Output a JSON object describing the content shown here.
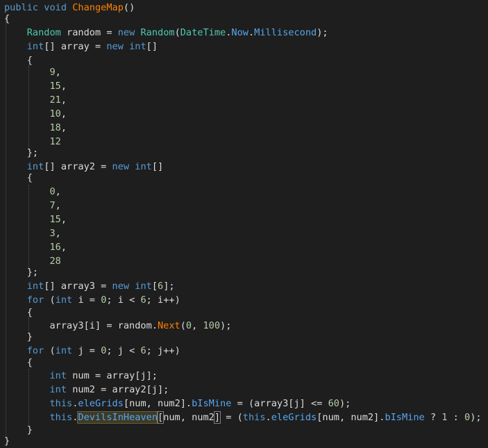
{
  "editor": {
    "lines": [
      [
        [
          "public ",
          "kw"
        ],
        [
          "void ",
          "kw"
        ],
        [
          "ChangeMap",
          "fn"
        ],
        [
          "()",
          "pl"
        ]
      ],
      [
        [
          "{",
          "pl"
        ]
      ],
      [
        [
          "    ",
          "pl"
        ],
        [
          "Random",
          "ty"
        ],
        [
          " random = ",
          "pl"
        ],
        [
          "new ",
          "kw"
        ],
        [
          "Random",
          "ty"
        ],
        [
          "(",
          "pl"
        ],
        [
          "DateTime",
          "ty"
        ],
        [
          ".",
          "pl"
        ],
        [
          "Now",
          "mem"
        ],
        [
          ".",
          "pl"
        ],
        [
          "Millisecond",
          "mem"
        ],
        [
          ");",
          "pl"
        ]
      ],
      [
        [
          "    ",
          "pl"
        ],
        [
          "int",
          "kw"
        ],
        [
          "[] array = ",
          "pl"
        ],
        [
          "new ",
          "kw"
        ],
        [
          "int",
          "kw"
        ],
        [
          "[]",
          "pl"
        ]
      ],
      [
        [
          "    {",
          "pl"
        ]
      ],
      [
        [
          "        ",
          "pl"
        ],
        [
          "9",
          "nm"
        ],
        [
          ",",
          "pl"
        ]
      ],
      [
        [
          "        ",
          "pl"
        ],
        [
          "15",
          "nm"
        ],
        [
          ",",
          "pl"
        ]
      ],
      [
        [
          "        ",
          "pl"
        ],
        [
          "21",
          "nm"
        ],
        [
          ",",
          "pl"
        ]
      ],
      [
        [
          "        ",
          "pl"
        ],
        [
          "10",
          "nm"
        ],
        [
          ",",
          "pl"
        ]
      ],
      [
        [
          "        ",
          "pl"
        ],
        [
          "18",
          "nm"
        ],
        [
          ",",
          "pl"
        ]
      ],
      [
        [
          "        ",
          "pl"
        ],
        [
          "12",
          "nm"
        ]
      ],
      [
        [
          "    };",
          "pl"
        ]
      ],
      [
        [
          "    ",
          "pl"
        ],
        [
          "int",
          "kw"
        ],
        [
          "[] array2 = ",
          "pl"
        ],
        [
          "new ",
          "kw"
        ],
        [
          "int",
          "kw"
        ],
        [
          "[]",
          "pl"
        ]
      ],
      [
        [
          "    {",
          "pl"
        ]
      ],
      [
        [
          "        ",
          "pl"
        ],
        [
          "0",
          "nm"
        ],
        [
          ",",
          "pl"
        ]
      ],
      [
        [
          "        ",
          "pl"
        ],
        [
          "7",
          "nm"
        ],
        [
          ",",
          "pl"
        ]
      ],
      [
        [
          "        ",
          "pl"
        ],
        [
          "15",
          "nm"
        ],
        [
          ",",
          "pl"
        ]
      ],
      [
        [
          "        ",
          "pl"
        ],
        [
          "3",
          "nm"
        ],
        [
          ",",
          "pl"
        ]
      ],
      [
        [
          "        ",
          "pl"
        ],
        [
          "16",
          "nm"
        ],
        [
          ",",
          "pl"
        ]
      ],
      [
        [
          "        ",
          "pl"
        ],
        [
          "28",
          "nm"
        ]
      ],
      [
        [
          "    };",
          "pl"
        ]
      ],
      [
        [
          "    ",
          "pl"
        ],
        [
          "int",
          "kw"
        ],
        [
          "[] array3 = ",
          "pl"
        ],
        [
          "new ",
          "kw"
        ],
        [
          "int",
          "kw"
        ],
        [
          "[",
          "pl"
        ],
        [
          "6",
          "nm"
        ],
        [
          "];",
          "pl"
        ]
      ],
      [
        [
          "    ",
          "pl"
        ],
        [
          "for ",
          "kw"
        ],
        [
          "(",
          "pl"
        ],
        [
          "int ",
          "kw"
        ],
        [
          "i = ",
          "pl"
        ],
        [
          "0",
          "nm"
        ],
        [
          "; i < ",
          "pl"
        ],
        [
          "6",
          "nm"
        ],
        [
          "; i++)",
          "pl"
        ]
      ],
      [
        [
          "    {",
          "pl"
        ]
      ],
      [
        [
          "        array3[i] = random.",
          "pl"
        ],
        [
          "Next",
          "fn"
        ],
        [
          "(",
          "pl"
        ],
        [
          "0",
          "nm"
        ],
        [
          ", ",
          "pl"
        ],
        [
          "100",
          "nm"
        ],
        [
          ");",
          "pl"
        ]
      ],
      [
        [
          "    }",
          "pl"
        ]
      ],
      [
        [
          "    ",
          "pl"
        ],
        [
          "for ",
          "kw"
        ],
        [
          "(",
          "pl"
        ],
        [
          "int ",
          "kw"
        ],
        [
          "j = ",
          "pl"
        ],
        [
          "0",
          "nm"
        ],
        [
          "; j < ",
          "pl"
        ],
        [
          "6",
          "nm"
        ],
        [
          "; j++)",
          "pl"
        ]
      ],
      [
        [
          "    {",
          "pl"
        ]
      ],
      [
        [
          "        ",
          "pl"
        ],
        [
          "int ",
          "kw"
        ],
        [
          "num = array[j];",
          "pl"
        ]
      ],
      [
        [
          "        ",
          "pl"
        ],
        [
          "int ",
          "kw"
        ],
        [
          "num2 = array2[j];",
          "pl"
        ]
      ],
      [
        [
          "        ",
          "pl"
        ],
        [
          "this",
          "kw"
        ],
        [
          ".",
          "pl"
        ],
        [
          "eleGrids",
          "mem"
        ],
        [
          "[num, num2].",
          "pl"
        ],
        [
          "bIsMine",
          "mem"
        ],
        [
          " = (array3[j] <= ",
          "pl"
        ],
        [
          "60",
          "nm"
        ],
        [
          ");",
          "pl"
        ]
      ],
      [
        [
          "        ",
          "pl"
        ],
        [
          "this",
          "kw"
        ],
        [
          ".",
          "pl"
        ],
        [
          "DevilsInHeaven",
          "mem hl"
        ],
        [
          "[",
          "pl br"
        ],
        [
          "num, num2",
          "pl"
        ],
        [
          "]",
          "pl br"
        ],
        [
          " = (",
          "pl"
        ],
        [
          "this",
          "kw"
        ],
        [
          ".",
          "pl"
        ],
        [
          "eleGrids",
          "mem"
        ],
        [
          "[num, num2].",
          "pl"
        ],
        [
          "bIsMine",
          "mem"
        ],
        [
          " ? ",
          "pl"
        ],
        [
          "1",
          "nm"
        ],
        [
          " : ",
          "pl"
        ],
        [
          "0",
          "nm"
        ],
        [
          ");",
          "pl"
        ]
      ],
      [
        [
          "    }",
          "pl"
        ]
      ],
      [
        [
          "}",
          "pl"
        ]
      ]
    ]
  },
  "colors": {
    "background": "#1e1e1e",
    "keyword": "#569cd6",
    "type": "#4ec9b0",
    "method": "#ff8000",
    "member": "#57a6f0",
    "number": "#b5cea8",
    "text": "#dcdcdc",
    "highlight": "#3d3a26"
  }
}
